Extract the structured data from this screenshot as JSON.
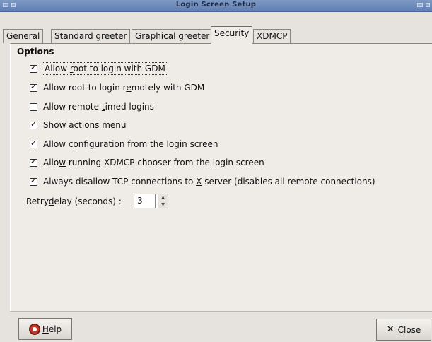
{
  "window": {
    "title": "Login Screen Setup"
  },
  "tabs": [
    {
      "label": "General",
      "active": false
    },
    {
      "label": "Standard greeter",
      "active": false
    },
    {
      "label": "Graphical greeter",
      "active": false
    },
    {
      "label": "Security",
      "active": true
    },
    {
      "label": "XDMCP",
      "active": false
    }
  ],
  "options": {
    "title": "Options",
    "items": [
      {
        "pre": "Allow ",
        "mnemonic": "r",
        "post": "oot to login with GDM",
        "checked": true
      },
      {
        "pre": "Allow root to login r",
        "mnemonic": "e",
        "post": "motely with GDM",
        "checked": true
      },
      {
        "pre": "Allow remote ",
        "mnemonic": "t",
        "post": "imed logins",
        "checked": false
      },
      {
        "pre": "Show ",
        "mnemonic": "a",
        "post": "ctions menu",
        "checked": true
      },
      {
        "pre": "Allow c",
        "mnemonic": "o",
        "post": "nfiguration from the login screen",
        "checked": true
      },
      {
        "pre": "Allo",
        "mnemonic": "w",
        "post": " running XDMCP chooser from the login screen",
        "checked": true
      },
      {
        "pre": "Always disallow TCP connections to ",
        "mnemonic": "X",
        "post": " server (disables all remote connections)",
        "checked": true
      }
    ]
  },
  "retry": {
    "label_pre": "Retry ",
    "label_mnemonic": "d",
    "label_post": "elay (seconds) :",
    "value": "3"
  },
  "buttons": {
    "help": {
      "mnemonic": "H",
      "rest": "elp"
    },
    "close": {
      "mnemonic": "C",
      "rest": "lose"
    }
  },
  "colors": {
    "titlebar": "#5f7fb3",
    "background": "#e6e3df",
    "panel": "#efece8"
  }
}
